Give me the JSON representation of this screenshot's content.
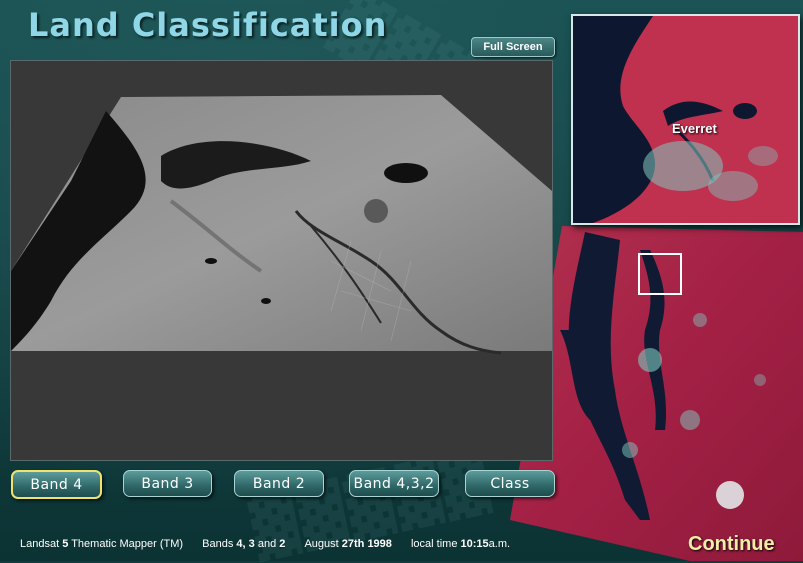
{
  "app": {
    "title": "Land Classification"
  },
  "toolbar": {
    "fullscreen_label": "Full Screen"
  },
  "inset": {
    "place_label": "Everret"
  },
  "bands": [
    {
      "label": "Band 4",
      "active": true
    },
    {
      "label": "Band 3",
      "active": false
    },
    {
      "label": "Band 2",
      "active": false
    },
    {
      "label": "Band 4,3,2",
      "active": false
    },
    {
      "label": "Class",
      "active": false
    }
  ],
  "footer": {
    "sensor_prefix": "Landsat",
    "sensor_num": "5",
    "sensor_suffix": "Thematic Mapper (TM)",
    "bands_prefix": "Bands",
    "bands_a": "4,",
    "bands_b": "3",
    "bands_and": "and",
    "bands_c": "2",
    "date_month": "August",
    "date_day": "27th",
    "date_year": "1998",
    "time_prefix": "local time",
    "time_value": "10:15",
    "time_suffix": "a.m."
  },
  "continue_label": "Continue",
  "colors": {
    "accent": "#8fd6e6",
    "active_border": "#f0e26a",
    "continue": "#f4eda8",
    "button_bg": "#2f6768"
  }
}
